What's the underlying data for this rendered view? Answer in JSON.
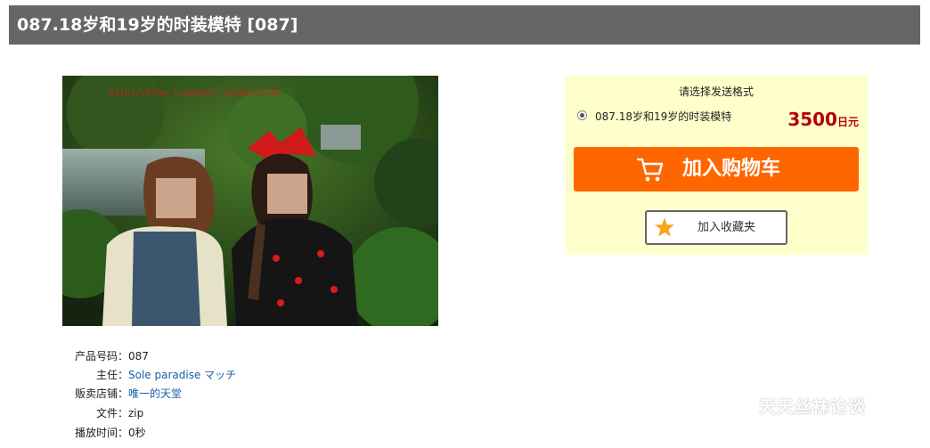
{
  "page": {
    "title": "087.18岁和19岁的时装模特 [087]"
  },
  "photo": {
    "watermark_url": "http://blog.livedoor.jp/match130"
  },
  "product_info": {
    "code": {
      "label": "产品号码：",
      "value": "087"
    },
    "lead": {
      "label": "主任：",
      "value": "Sole paradise マッチ"
    },
    "shop": {
      "label": "贩卖店铺：",
      "value": "唯一的天堂"
    },
    "file": {
      "label": "文件：",
      "value": "zip"
    },
    "duration": {
      "label": "播放时间：",
      "value": "0秒"
    }
  },
  "purchase": {
    "format_title": "请选择发送格式",
    "option_label": "087.18岁和19岁的时装模特",
    "option_selected": true,
    "price": "3500",
    "price_unit": "日元",
    "cart_button": "加入购物车",
    "favorite_button": "加入收藏夹",
    "accent_color": "#ff6600",
    "panel_color": "#ffffcc",
    "price_color": "#b60000"
  },
  "watermark": {
    "site_text": "天天丝袜论谈"
  },
  "icons": {
    "cart": "cart-icon",
    "favorite": "star-icon",
    "radio": "radio-selected-icon"
  }
}
